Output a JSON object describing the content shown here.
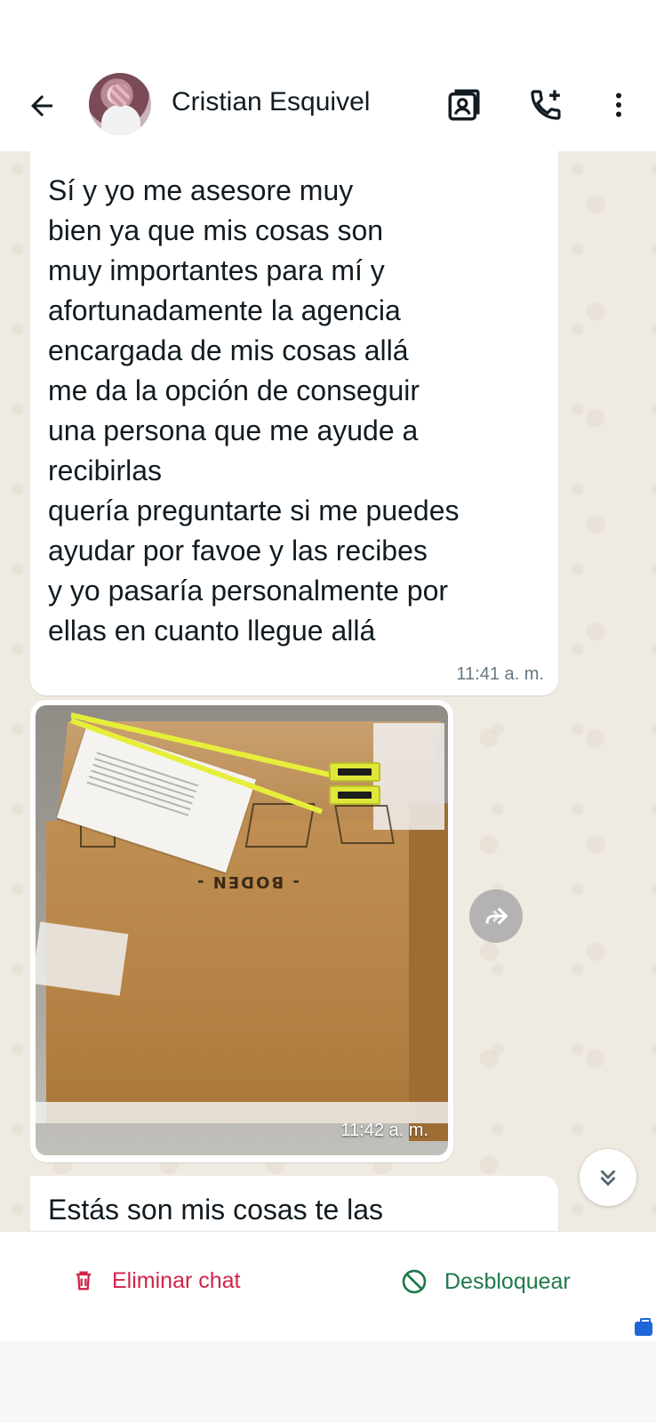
{
  "header": {
    "contact_name": "Cristian Esquivel",
    "back_icon": "arrow-left-icon",
    "contact_card_icon": "contact-card-icon",
    "add_call_icon": "phone-plus-icon",
    "menu_icon": "more-vertical-icon"
  },
  "messages": [
    {
      "text": "Sí y yo me asesore muy\nbien ya que mis cosas son\nmuy importantes para mí y\nafortunadamente la agencia\nencargada de mis cosas allá\nme da la opción de conseguir\nuna persona que me ayude a\nrecibirlas\nquería preguntarte si me puedes\nayudar por favoe  y las recibes\ny yo pasaría personalmente por\nellas en cuanto llegue allá",
      "time": "11:41 a. m."
    },
    {
      "type": "image",
      "box_label": "- BODEN -",
      "time": "11:42 a. m."
    },
    {
      "text": "Estás son mis cosas te las"
    }
  ],
  "bottom_actions": {
    "delete_label": "Eliminar chat",
    "unblock_label": "Desbloquear"
  },
  "colors": {
    "delete": "#d0244a",
    "unblock": "#1f7a4a",
    "chat_bg": "#efeae2"
  }
}
